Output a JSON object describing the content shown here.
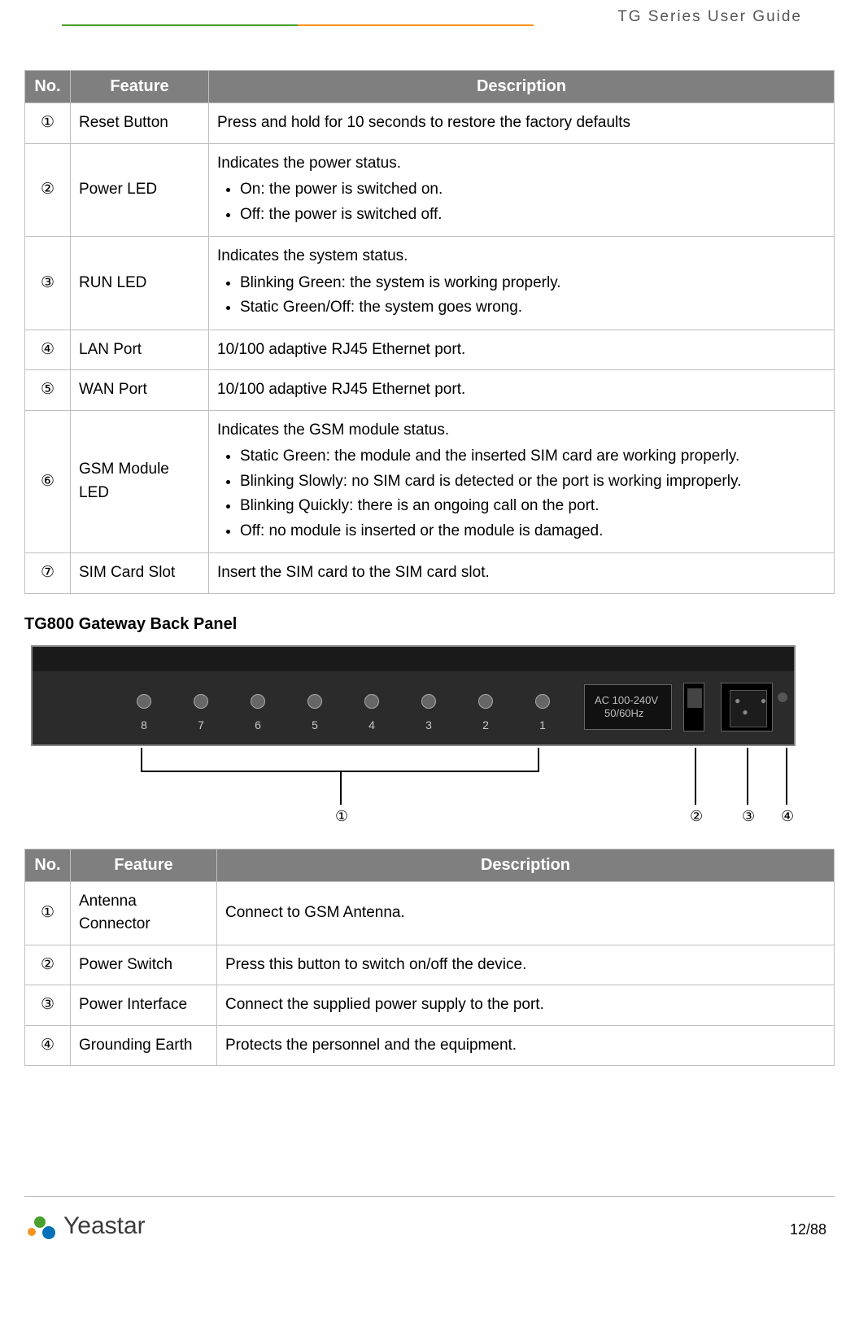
{
  "header": {
    "title": "TG  Series  User  Guide"
  },
  "table1": {
    "head": {
      "no": "No.",
      "feature": "Feature",
      "desc": "Description"
    },
    "rows": [
      {
        "no": "①",
        "feature": "Reset Button",
        "desc_text": "Press and hold for 10 seconds to restore the factory defaults"
      },
      {
        "no": "②",
        "feature": "Power LED",
        "intro": "Indicates the power status.",
        "bullets": [
          "On: the power is switched on.",
          "Off: the power is switched off."
        ]
      },
      {
        "no": "③",
        "feature": "RUN LED",
        "intro": "Indicates the system status.",
        "bullets": [
          "Blinking Green: the system is working properly.",
          "Static Green/Off: the system goes wrong."
        ]
      },
      {
        "no": "④",
        "feature": "LAN Port",
        "desc_text": "10/100 adaptive RJ45 Ethernet port."
      },
      {
        "no": "⑤",
        "feature": "WAN Port",
        "desc_text": "10/100 adaptive RJ45 Ethernet port."
      },
      {
        "no": "⑥",
        "feature": "GSM Module LED",
        "intro": "Indicates the GSM module status.",
        "bullets": [
          "Static Green: the module and the inserted SIM card are working properly.",
          "Blinking Slowly: no SIM card is detected or the port is working improperly.",
          "Blinking Quickly: there is an ongoing call on the port.",
          "Off: no module is inserted or the module is damaged."
        ]
      },
      {
        "no": "⑦",
        "feature": "SIM Card Slot",
        "desc_text": "Insert the SIM card to the SIM card slot."
      }
    ]
  },
  "subheading": "TG800 Gateway Back Panel",
  "panel": {
    "antenna_labels": [
      "8",
      "7",
      "6",
      "5",
      "4",
      "3",
      "2",
      "1"
    ],
    "ac_label_line1": "AC 100-240V",
    "ac_label_line2": "50/60Hz",
    "callouts": {
      "ant": "①",
      "sw": "②",
      "iec": "③",
      "gnd": "④"
    }
  },
  "table2": {
    "head": {
      "no": "No.",
      "feature": "Feature",
      "desc": "Description"
    },
    "rows": [
      {
        "no": "①",
        "feature": "Antenna Connector",
        "desc_text": "Connect to GSM Antenna."
      },
      {
        "no": "②",
        "feature": "Power Switch",
        "desc_text": "Press this button to switch on/off the device."
      },
      {
        "no": "③",
        "feature": "Power Interface",
        "desc_text": "Connect the supplied power supply to the port."
      },
      {
        "no": "④",
        "feature": "Grounding Earth",
        "desc_text": "Protects the personnel and the equipment."
      }
    ]
  },
  "footer": {
    "brand": "Yeastar",
    "page": "12/88"
  }
}
